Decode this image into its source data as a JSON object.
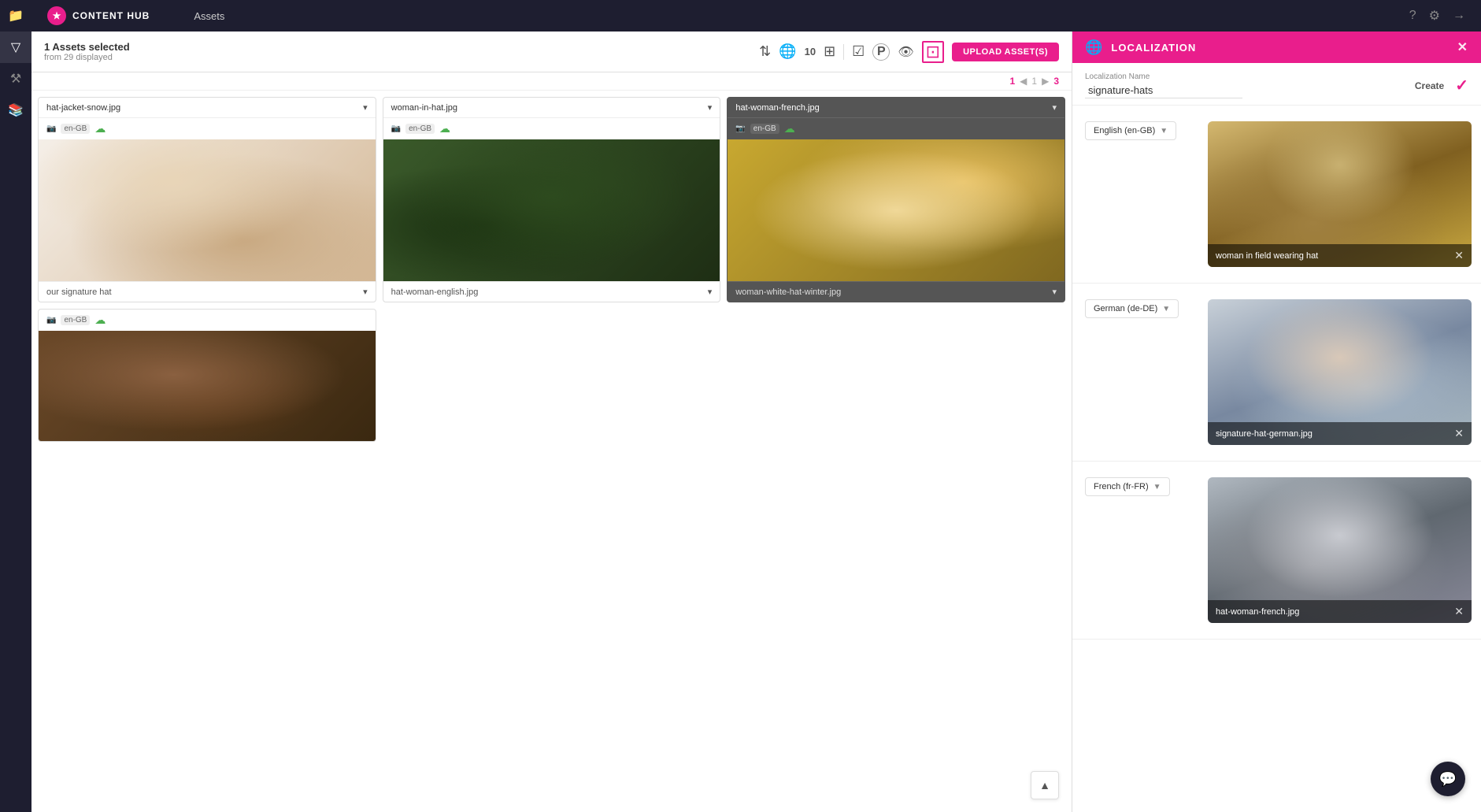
{
  "app": {
    "brand": "CONTENT HUB",
    "logo_symbol": "★"
  },
  "topbar": {
    "title": "Assets",
    "help_icon": "?",
    "settings_icon": "⚙",
    "logout_icon": "→"
  },
  "sidebar": {
    "items": [
      {
        "icon": "folder",
        "label": "Files",
        "symbol": "📁"
      },
      {
        "icon": "filter",
        "label": "Filter",
        "symbol": "▽"
      },
      {
        "icon": "tools",
        "label": "Tools",
        "symbol": "⚒"
      },
      {
        "icon": "book",
        "label": "Library",
        "symbol": "📚"
      }
    ]
  },
  "assets_toolbar": {
    "selected_count": "1 Assets selected",
    "from_text": "from 29 displayed",
    "sort_icon": "⇅",
    "globe_icon": "🌐",
    "count": "10",
    "grid_icon": "⊞",
    "check_icon": "☑",
    "p_icon": "P",
    "eye_icon": "👁",
    "select_icon": "⊡",
    "upload_button": "UPLOAD ASSET(S)"
  },
  "pagination": {
    "page_current": "1",
    "page_prev": "◀",
    "page_next": "▶",
    "page_total": "3",
    "of_text": "/"
  },
  "assets": [
    {
      "id": "asset-1",
      "filename": "hat-jacket-snow.jpg",
      "locale": "en-GB",
      "selected": false,
      "name": "our signature hat",
      "thumb_type": "1"
    },
    {
      "id": "asset-2",
      "filename": "woman-in-hat.jpg",
      "locale": "en-GB",
      "selected": false,
      "name": "hat-woman-english.jpg",
      "thumb_type": "2"
    },
    {
      "id": "asset-3",
      "filename": "hat-woman-french.jpg",
      "locale": "en-GB",
      "selected": true,
      "name": "woman-white-hat-winter.jpg",
      "thumb_type": "3"
    },
    {
      "id": "asset-4",
      "filename": "",
      "locale": "en-GB",
      "selected": false,
      "name": "",
      "thumb_type": "4"
    }
  ],
  "localization": {
    "header_title": "LOCALIZATION",
    "name_label": "Localization Name",
    "name_value": "signature-hats",
    "create_label": "Create",
    "check_symbol": "✓",
    "close_symbol": "✕",
    "languages": [
      {
        "id": "en-GB",
        "label": "English (en-GB)",
        "image_filename": "woman in field wearing hat",
        "image_close": "✕",
        "thumb_type": "loc1"
      },
      {
        "id": "de-DE",
        "label": "German (de-DE)",
        "image_filename": "signature-hat-german.jpg",
        "image_close": "✕",
        "thumb_type": "loc2"
      },
      {
        "id": "fr-FR",
        "label": "French (fr-FR)",
        "image_filename": "hat-woman-french.jpg",
        "image_close": "✕",
        "thumb_type": "loc3"
      }
    ]
  }
}
